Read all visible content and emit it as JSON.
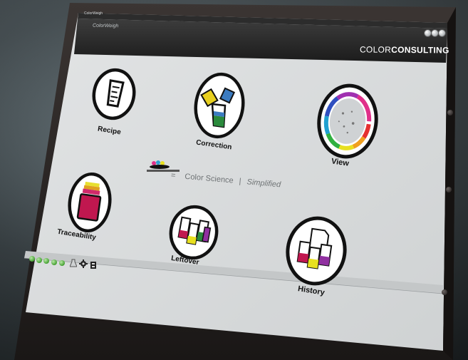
{
  "window": {
    "titlebar_text": "ColorWeigh",
    "app_title": "ColorWeigh"
  },
  "brand": {
    "light": "COLOR",
    "bold": "CONSULTING"
  },
  "tiles": [
    {
      "id": "recipe",
      "label": "Recipe",
      "icon": "beaker-measure-icon"
    },
    {
      "id": "correction",
      "label": "Correction",
      "icon": "pouring-beakers-icon"
    },
    {
      "id": "view",
      "label": "View",
      "icon": "color-wheel-icon"
    },
    {
      "id": "traceability",
      "label": "Traceability",
      "icon": "paint-can-stack-icon"
    },
    {
      "id": "leftover",
      "label": "Leftover",
      "icon": "colored-beakers-icon"
    },
    {
      "id": "history",
      "label": "History",
      "icon": "document-beakers-icon"
    }
  ],
  "tagline": {
    "equals": "=",
    "main": "Color Science",
    "divider": "|",
    "accent": "Simplified"
  },
  "statusbar": {
    "indicator_count": 5,
    "icons": [
      "lab-flask-icon",
      "gear-icon",
      "scale-icon"
    ]
  },
  "colors": {
    "indicator_green": "#43a030",
    "screen_bg": "#d9dcdd",
    "bezel": "#2a2624",
    "accent_magenta": "#c0174f"
  }
}
